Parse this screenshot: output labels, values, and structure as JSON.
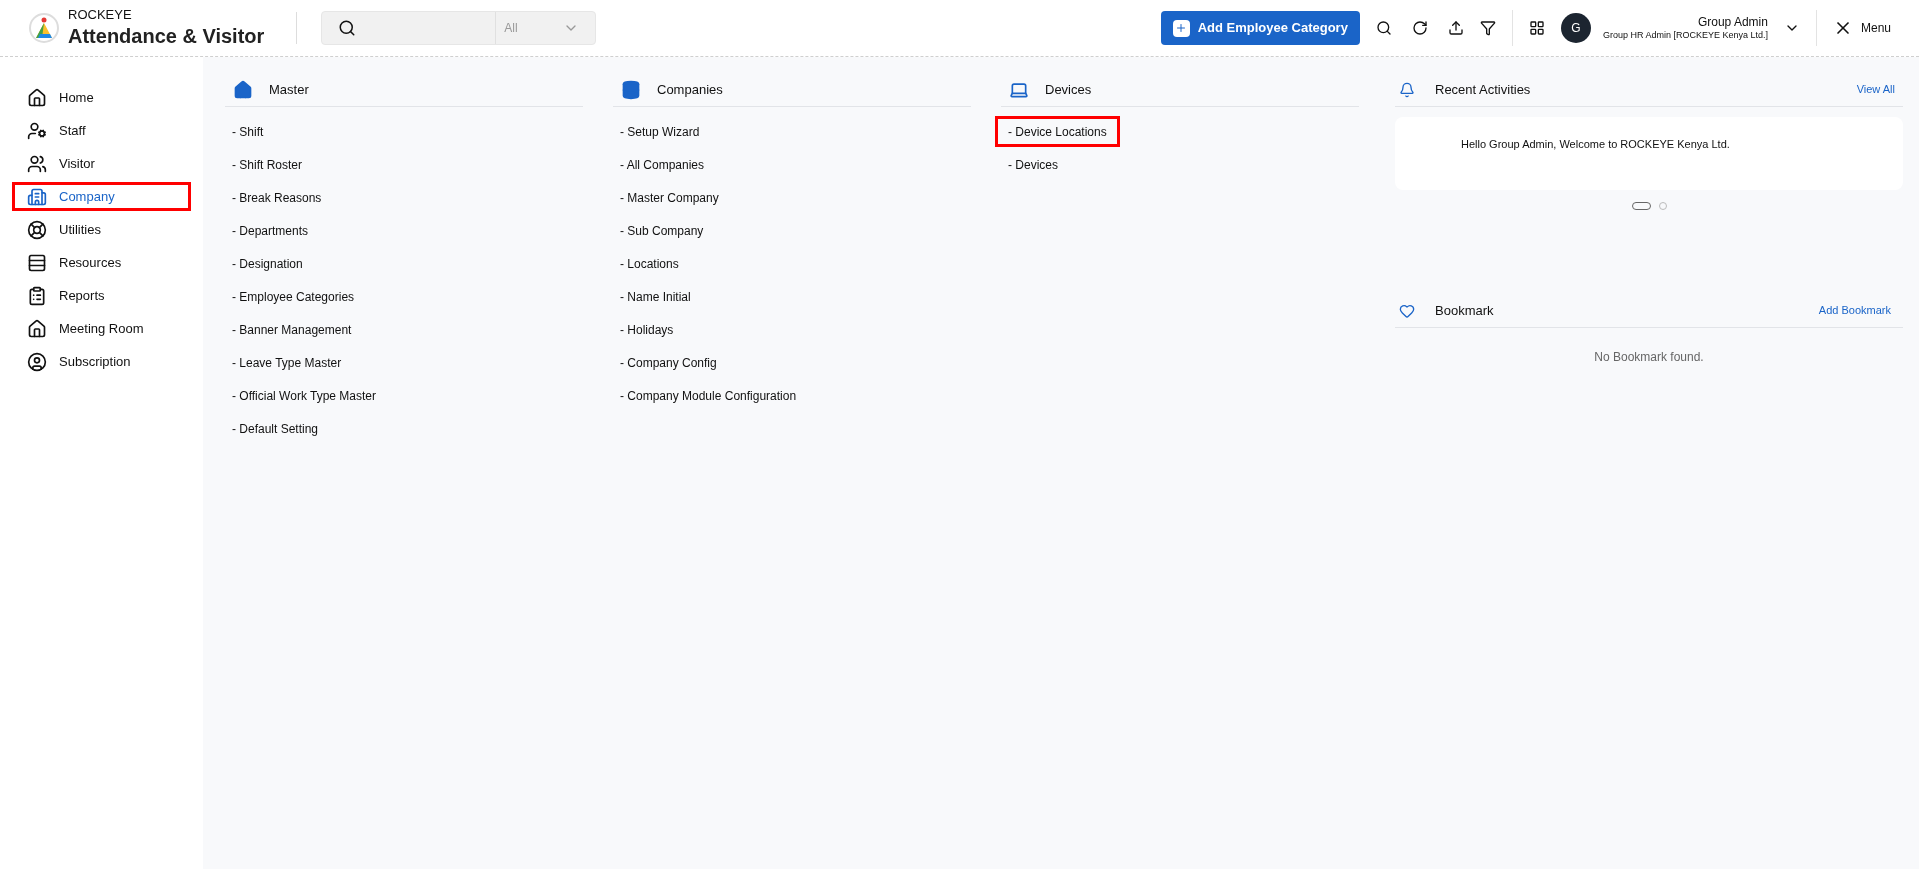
{
  "header": {
    "brand_top": "ROCKEYE",
    "brand_name": "Attendance & Visitor",
    "search": {
      "scope": "All"
    },
    "add_button": "Add Employee Category",
    "avatar_letter": "G",
    "user_name": "Group Admin",
    "user_role": "Group HR Admin [ROCKEYE Kenya Ltd.]",
    "menu_label": "Menu"
  },
  "sidebar": {
    "items": [
      {
        "label": "Home",
        "selected": false,
        "highlighted": false
      },
      {
        "label": "Staff",
        "selected": false,
        "highlighted": false
      },
      {
        "label": "Visitor",
        "selected": false,
        "highlighted": false
      },
      {
        "label": "Company",
        "selected": true,
        "highlighted": true
      },
      {
        "label": "Utilities",
        "selected": false,
        "highlighted": false
      },
      {
        "label": "Resources",
        "selected": false,
        "highlighted": false
      },
      {
        "label": "Reports",
        "selected": false,
        "highlighted": false
      },
      {
        "label": "Meeting Room",
        "selected": false,
        "highlighted": false
      },
      {
        "label": "Subscription",
        "selected": false,
        "highlighted": false
      }
    ]
  },
  "sections": [
    {
      "title": "Master",
      "links": [
        {
          "label": "- Shift",
          "highlighted": false
        },
        {
          "label": "- Shift Roster",
          "highlighted": false
        },
        {
          "label": "- Break Reasons",
          "highlighted": false
        },
        {
          "label": "- Departments",
          "highlighted": false
        },
        {
          "label": "- Designation",
          "highlighted": false
        },
        {
          "label": "- Employee Categories",
          "highlighted": false
        },
        {
          "label": "- Banner Management",
          "highlighted": false
        },
        {
          "label": "- Leave Type Master",
          "highlighted": false
        },
        {
          "label": "- Official Work Type Master",
          "highlighted": false
        },
        {
          "label": "- Default Setting",
          "highlighted": false
        }
      ]
    },
    {
      "title": "Companies",
      "links": [
        {
          "label": "- Setup Wizard",
          "highlighted": false
        },
        {
          "label": "- All Companies",
          "highlighted": false
        },
        {
          "label": "- Master Company",
          "highlighted": false
        },
        {
          "label": "- Sub Company",
          "highlighted": false
        },
        {
          "label": "- Locations",
          "highlighted": false
        },
        {
          "label": "- Name Initial",
          "highlighted": false
        },
        {
          "label": "- Holidays",
          "highlighted": false
        },
        {
          "label": "- Company Config",
          "highlighted": false
        },
        {
          "label": "- Company Module Configuration",
          "highlighted": false
        }
      ]
    },
    {
      "title": "Devices",
      "links": [
        {
          "label": "- Device Locations",
          "highlighted": true
        },
        {
          "label": "- Devices",
          "highlighted": false
        }
      ]
    }
  ],
  "recent_activities": {
    "title": "Recent Activities",
    "link": "View All",
    "message": "Hello Group Admin, Welcome to ROCKEYE Kenya Ltd.",
    "slides": [
      {
        "selected": true
      },
      {
        "selected": false
      }
    ]
  },
  "bookmark": {
    "title": "Bookmark",
    "link": "Add Bookmark",
    "empty": "No Bookmark found."
  }
}
